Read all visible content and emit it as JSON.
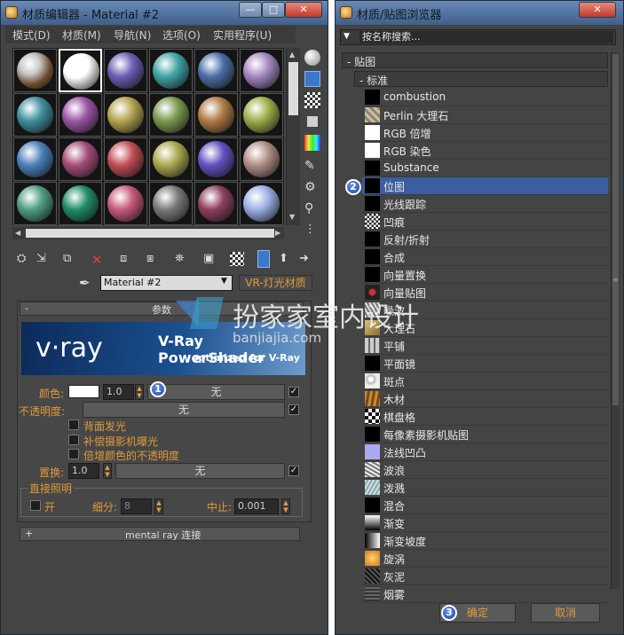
{
  "material_editor": {
    "title": "材质编辑器 - Material #2",
    "menu": [
      "模式(D)",
      "材质(M)",
      "导航(N)",
      "选项(O)",
      "实用程序(U)"
    ],
    "spheres": [
      "#4d78b6",
      "#ffffff",
      "#6a5fb3",
      "#3fa3a6",
      "#4b6ea6",
      "#a487c2",
      "#3f8e9c",
      "#9b55a5",
      "#b4a451",
      "#7a9a4f",
      "#b07a46",
      "#9dae48",
      "#4a7fba",
      "#a54d7a",
      "#c04d55",
      "#a9a84e",
      "#6450c1",
      "#b08f86",
      "#4e9e86",
      "#1f8c66",
      "#c65a7a",
      "#7a7a7a",
      "#8e3f5e",
      "#9cb0e6"
    ],
    "material_name": "Material #2",
    "material_type": "VR-灯光材质",
    "params_label": "参数",
    "banner": {
      "brand": "v·ray",
      "line1": "V-Ray PowerShader",
      "line2": "optimized for V-Ray"
    },
    "color_label": "颜色:",
    "color_value": "1.0",
    "none_label": "无",
    "opacity_label": "不透明度:",
    "check_back": "背面发光",
    "check_comp": "补偿摄影机曝光",
    "check_mult": "倍增颜色的不透明度",
    "displace_label": "置换:",
    "displace_value": "1.0",
    "direct_group": "直接照明",
    "on_label": "开",
    "subdiv_label": "细分:",
    "subdiv_value": "8",
    "cutoff_label": "中止:",
    "cutoff_value": "0.001",
    "mentalray_label": "mental ray 连接",
    "plus": "+",
    "minus": "-"
  },
  "browser": {
    "title": "材质/贴图浏览器",
    "search_placeholder": "按名称搜索...",
    "group_maps": "- 贴图",
    "group_standard": "- 标准",
    "items": [
      "combustion",
      "Perlin 大理石",
      "RGB 倍增",
      "RGB 染色",
      "Substance",
      "位图",
      "光线跟踪",
      "凹痕",
      "反射/折射",
      "合成",
      "向量置换",
      "向量贴图",
      "噪波",
      "大理石",
      "平铺",
      "平面镜",
      "斑点",
      "木材",
      "棋盘格",
      "每像素摄影机贴图",
      "法线凹凸",
      "波浪",
      "泼溅",
      "混合",
      "渐变",
      "渐变坡度",
      "旋涡",
      "灰泥",
      "烟雾"
    ],
    "ok_label": "确定",
    "cancel_label": "取消"
  },
  "badges": [
    "1",
    "2",
    "3"
  ],
  "watermark": {
    "text": "扮家家室内设计",
    "url": "banjiajia.com"
  }
}
